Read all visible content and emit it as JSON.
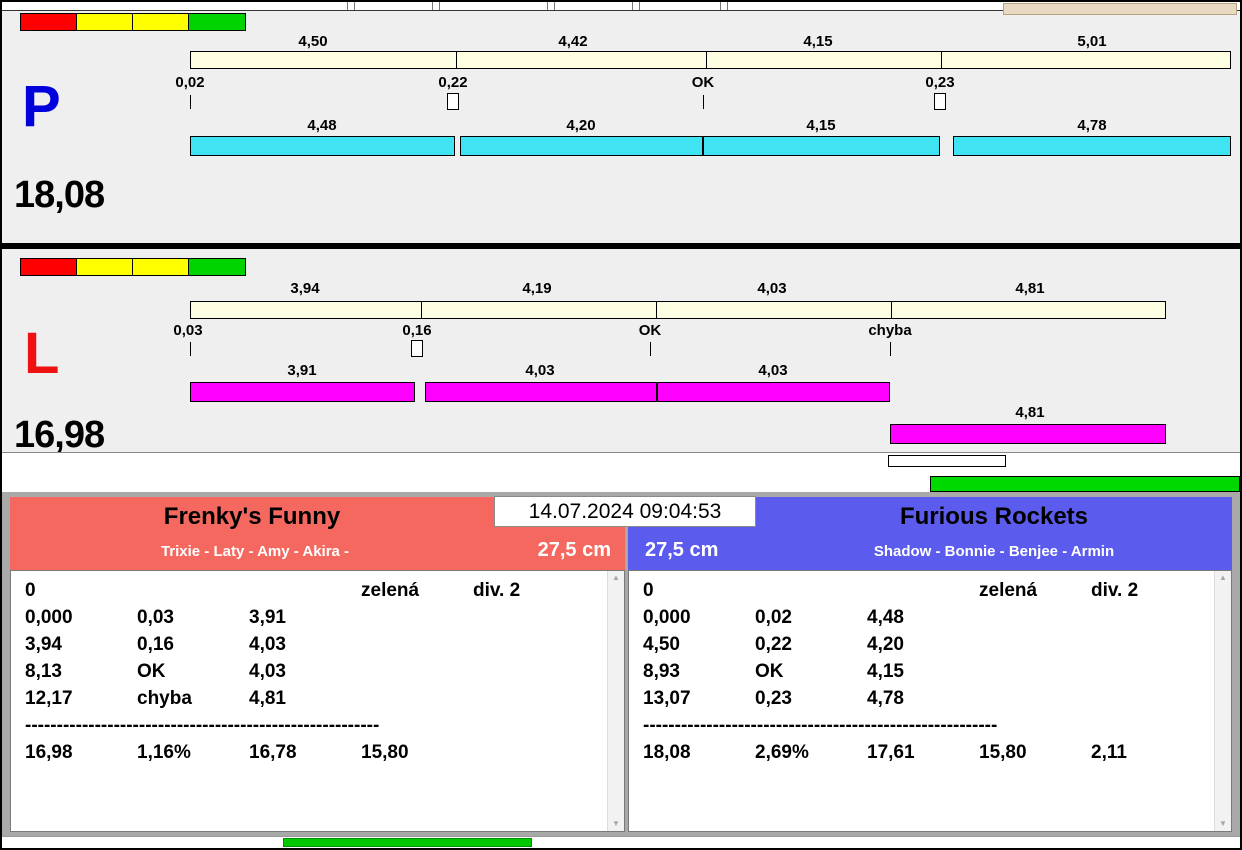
{
  "timestamp": "14.07.2024 09:04:53",
  "ui": {
    "scroll_up": "▲",
    "scroll_down": "▼"
  },
  "misc": {
    "top_note_color": "#e9d9c0",
    "green_bar_color": "#00d900",
    "bottom_green_color": "#00c800"
  },
  "lanes": [
    {
      "letter": "P",
      "letter_color": "#0000dd",
      "total": "18,08",
      "lights": [
        "#ff0000",
        "#ffff00",
        "#ffff00",
        "#00d400"
      ],
      "plan_segments": [
        "4,50",
        "4,42",
        "4,15",
        "5,01"
      ],
      "markers": [
        "0,02",
        "0,22",
        "OK",
        "0,23"
      ],
      "run_segments": [
        "4,48",
        "4,20",
        "4,15",
        "4,78"
      ],
      "run_color": "#3fe3f2"
    },
    {
      "letter": "L",
      "letter_color": "#ee1111",
      "total": "16,98",
      "lights": [
        "#ff0000",
        "#ffff00",
        "#ffff00",
        "#00d400"
      ],
      "plan_segments": [
        "3,94",
        "4,19",
        "4,03",
        "4,81"
      ],
      "markers": [
        "0,03",
        "0,16",
        "OK",
        "chyba"
      ],
      "run_segments": [
        "3,91",
        "4,03",
        "4,03",
        "4,81"
      ],
      "run_color": "#ff00ff"
    }
  ],
  "teams": [
    {
      "name": "Frenky's Funny",
      "members": "Trixie - Laty - Amy - Akira -",
      "height": "27,5 cm",
      "header_color": "#f4685f",
      "rows": [
        [
          "0",
          "",
          "",
          "zelená",
          "div. 2"
        ],
        [
          "0,000",
          "0,03",
          "3,91",
          "",
          ""
        ],
        [
          "3,94",
          "0,16",
          "4,03",
          "",
          ""
        ],
        [
          "8,13",
          "OK",
          "4,03",
          "",
          ""
        ],
        [
          "12,17",
          "chyba",
          "4,81",
          "",
          ""
        ]
      ],
      "separator": "--------------------------------------------------------",
      "totals": [
        "16,98",
        "1,16%",
        "16,78",
        "15,80",
        ""
      ]
    },
    {
      "name": "Furious Rockets",
      "members": "Shadow - Bonnie - Benjee - Armin",
      "height": "27,5 cm",
      "header_color": "#5b5bee",
      "rows": [
        [
          "0",
          "",
          "",
          "zelená",
          "div. 2"
        ],
        [
          "0,000",
          "0,02",
          "4,48",
          "",
          ""
        ],
        [
          "4,50",
          "0,22",
          "4,20",
          "",
          ""
        ],
        [
          "8,93",
          "OK",
          "4,15",
          "",
          ""
        ],
        [
          "13,07",
          "0,23",
          "4,78",
          "",
          ""
        ]
      ],
      "separator": "--------------------------------------------------------",
      "totals": [
        "18,08",
        "2,69%",
        "17,61",
        "15,80",
        "2,11"
      ]
    }
  ]
}
